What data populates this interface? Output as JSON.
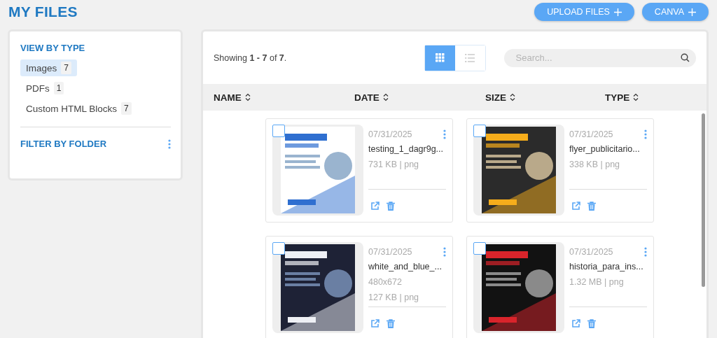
{
  "page_title": "MY FILES",
  "header_buttons": [
    "UPLOAD FILES",
    "CANVA"
  ],
  "sidebar": {
    "view_by_type_title": "VIEW BY TYPE",
    "types": [
      {
        "label": "Images",
        "count": "7",
        "selected": true
      },
      {
        "label": "PDFs",
        "count": "1",
        "selected": false
      },
      {
        "label": "Custom HTML Blocks",
        "count": "7",
        "selected": false
      }
    ],
    "filter_title": "FILTER BY FOLDER"
  },
  "toolbar": {
    "showing": "Showing **1 - 7** of **7**.",
    "views": [
      {
        "kind": "grid",
        "selected": true
      },
      {
        "kind": "list",
        "selected": false
      }
    ],
    "search": {
      "placeholder": "Search..."
    }
  },
  "columns": [
    "NAME",
    "DATE",
    "SIZE",
    "TYPE"
  ],
  "files": [
    {
      "date": "07/31/2025",
      "name": "testing_1_dagr9g...",
      "size": "731 KB | png",
      "checked": false,
      "kind": "picture"
    },
    {
      "date": "07/31/2025",
      "name": "flyer_publicitario...",
      "size": "338 KB | png",
      "checked": false,
      "kind": "picture"
    },
    {
      "date": "07/31/2025",
      "name": "white_and_blue_...",
      "dimensions": "480x672",
      "size": "127 KB | png",
      "checked": false,
      "kind": "picture"
    },
    {
      "date": "07/31/2025",
      "name": "historia_para_ins...",
      "size": "1.32 MB | png",
      "checked": false,
      "kind": "picture"
    }
  ]
}
